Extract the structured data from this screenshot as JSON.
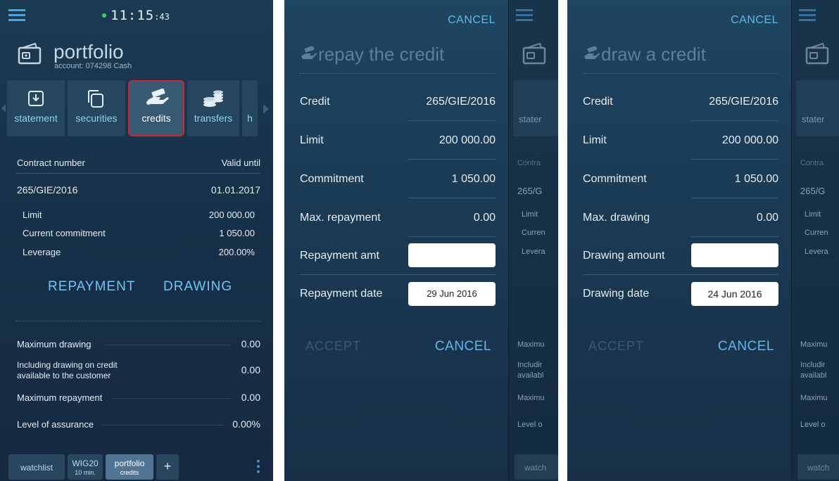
{
  "screen1": {
    "status": {
      "time_main": "11:15",
      "time_sec": ":43"
    },
    "header": {
      "title": "portfolio",
      "account": "account: 074298 Cash"
    },
    "nav": [
      {
        "label": "statement",
        "icon": "download-icon"
      },
      {
        "label": "securities",
        "icon": "copy-icon"
      },
      {
        "label": "credits",
        "icon": "hand-money-icon"
      },
      {
        "label": "transfers",
        "icon": "coins-icon"
      },
      {
        "label": "h",
        "icon": ""
      }
    ],
    "table": {
      "col_contract": "Contract number",
      "col_valid": "Valid until",
      "contract": "265/GIE/2016",
      "valid_until": "01.01.2017",
      "details": [
        {
          "label": "Limit",
          "value": "200 000.00"
        },
        {
          "label": "Current commitment",
          "value": "1 050.00"
        },
        {
          "label": "Leverage",
          "value": "200.00%"
        }
      ]
    },
    "actions": {
      "repayment": "REPAYMENT",
      "drawing": "DRAWING"
    },
    "summary": [
      {
        "label": "Maximum drawing",
        "value": "0.00"
      },
      {
        "label": "Including drawing on credit",
        "label2": "available to the customer",
        "value": "0.00"
      },
      {
        "label": "Maximum repayment",
        "value": "0.00"
      },
      {
        "label": "Level of assurance",
        "value": "0.00%"
      }
    ],
    "tabs": [
      {
        "label": "watchlist"
      },
      {
        "label": "WIG20",
        "sub": "10 min."
      },
      {
        "label": "portfolio",
        "sub": "credits"
      },
      {
        "label": "+"
      }
    ],
    "menu_glyph": "⋮"
  },
  "repay_dialog": {
    "cancel_top": "CANCEL",
    "title": "repay the credit",
    "rows": [
      {
        "label": "Credit",
        "value": "265/GIE/2016"
      },
      {
        "label": "Limit",
        "value": "200 000.00"
      },
      {
        "label": "Commitment",
        "value": "1 050.00"
      },
      {
        "label": "Max. repayment",
        "value": "0.00"
      }
    ],
    "amount_label": "Repayment amt",
    "amount_value": "",
    "date_label": "Repayment date",
    "date_value": "29 Jun 2016",
    "accept": "ACCEPT",
    "cancel": "CANCEL"
  },
  "draw_dialog": {
    "cancel_top": "CANCEL",
    "title": "draw a credit",
    "rows": [
      {
        "label": "Credit",
        "value": "265/GIE/2016"
      },
      {
        "label": "Limit",
        "value": "200 000.00"
      },
      {
        "label": "Commitment",
        "value": "1 050.00"
      },
      {
        "label": "Max. drawing",
        "value": "0.00"
      }
    ],
    "amount_label": "Drawing amount",
    "amount_value": "",
    "date_label": "Drawing date",
    "date_value": "24 Jun 2016",
    "accept": "ACCEPT",
    "cancel": "CANCEL"
  },
  "peek": {
    "nav_label": "stater",
    "col": "Contra",
    "contract": "265/G",
    "limit": "Limit",
    "current": "Curren",
    "leverage": "Levera",
    "max": "Maximu",
    "including": "Includir",
    "available": "availabl",
    "max_rep": "Maximu",
    "level": "Level o",
    "tab": "watch"
  },
  "colors": {
    "accent": "#4aa6dd",
    "highlight_border": "#d0262d",
    "background": "#17314a"
  }
}
